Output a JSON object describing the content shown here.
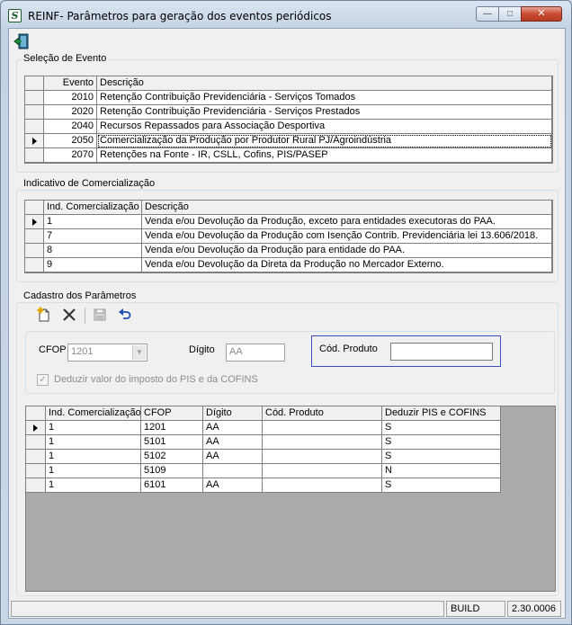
{
  "window": {
    "title": "REINF- Parâmetros para geração dos eventos periódicos",
    "min_label": "—",
    "max_label": "□",
    "close_label": "✕"
  },
  "evento_group": {
    "label": "Seleção de Evento",
    "columns": [
      "Evento",
      "Descrição"
    ],
    "rows": [
      {
        "evento": "2010",
        "descricao": "Retenção Contribuição Previdenciária - Serviços Tomados"
      },
      {
        "evento": "2020",
        "descricao": "Retenção Contribuição Previdenciária - Serviços Prestados"
      },
      {
        "evento": "2040",
        "descricao": "Recursos Repassados para Associação Desportiva"
      },
      {
        "evento": "2050",
        "descricao": "Comercialização da Produção por Produtor Rural PJ/Agroindústria"
      },
      {
        "evento": "2070",
        "descricao": "Retenções na Fonte - IR, CSLL, Cofins, PIS/PASEP"
      }
    ]
  },
  "indicativo_group": {
    "label": "Indicativo de Comercialização",
    "columns": [
      "Ind. Comercialização",
      "Descrição"
    ],
    "rows": [
      {
        "ind": "1",
        "descricao": "Venda e/ou Devolução da Produção, exceto para entidades executoras do PAA."
      },
      {
        "ind": "7",
        "descricao": "Venda e/ou Devolução da Produção com Isenção Contrib. Previdenciária lei 13.606/2018."
      },
      {
        "ind": "8",
        "descricao": "Venda e/ou Devolução da Produção para entidade do PAA."
      },
      {
        "ind": "9",
        "descricao": "Venda e/ou Devolução da Direta da Produção no Mercador Externo."
      }
    ]
  },
  "cadastro_group": {
    "label": "Cadastro dos Parâmetros",
    "cfop_label": "CFOP",
    "cfop_value": "1201",
    "digito_label": "Dígito",
    "digito_value": "AA",
    "cod_produto_label": "Cód. Produto",
    "cod_produto_value": "",
    "deduzir_label": "Deduzir valor do imposto do PIS e da COFINS",
    "deduzir_checked": "✓"
  },
  "params_grid": {
    "columns": [
      "Ind. Comercialização",
      "CFOP",
      "Dígito",
      "Cód. Produto",
      "Deduzir PIS e COFINS"
    ],
    "rows": [
      {
        "ind": "1",
        "cfop": "1201",
        "digito": "AA",
        "cod": "",
        "deduzir": "S"
      },
      {
        "ind": "1",
        "cfop": "5101",
        "digito": "AA",
        "cod": "",
        "deduzir": "S"
      },
      {
        "ind": "1",
        "cfop": "5102",
        "digito": "AA",
        "cod": "",
        "deduzir": "S"
      },
      {
        "ind": "1",
        "cfop": "5109",
        "digito": "",
        "cod": "",
        "deduzir": "N"
      },
      {
        "ind": "1",
        "cfop": "6101",
        "digito": "AA",
        "cod": "",
        "deduzir": "S"
      }
    ]
  },
  "statusbar": {
    "build_label": "BUILD",
    "version": "2.30.0006"
  },
  "colors": {
    "cod_produto_frame": "#3b4fc4",
    "grid_empty_area": "#ababab"
  }
}
